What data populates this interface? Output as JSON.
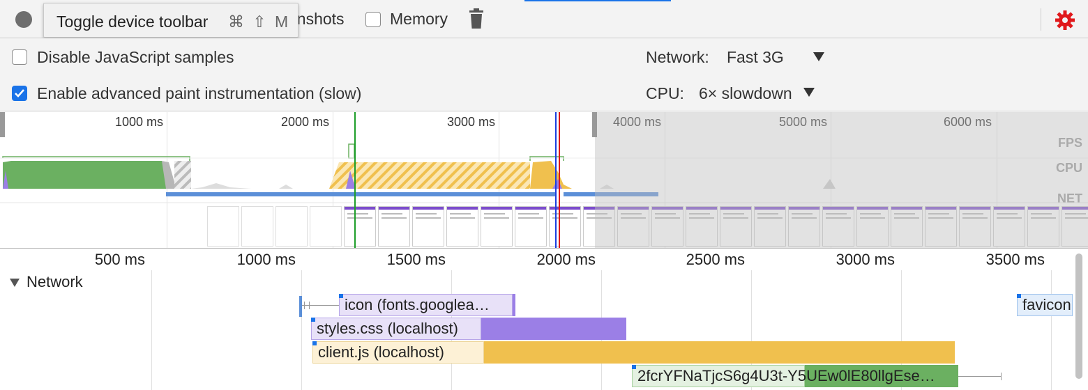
{
  "toolbar": {
    "tooltip_text": "Toggle device toolbar",
    "tooltip_shortcut": "⌘ ⇧ M",
    "screenshots_partial_label": "enshots",
    "memory_label": "Memory",
    "memory_checked": false
  },
  "settings": {
    "disable_js_samples_label": "Disable JavaScript samples",
    "disable_js_samples_checked": false,
    "advanced_paint_label": "Enable advanced paint instrumentation (slow)",
    "advanced_paint_checked": true,
    "network_label": "Network:",
    "network_value": "Fast 3G",
    "cpu_label": "CPU:",
    "cpu_value": "6× slowdown"
  },
  "overview": {
    "time_labels": [
      "1000 ms",
      "2000 ms",
      "3000 ms",
      "4000 ms",
      "5000 ms",
      "6000 ms"
    ],
    "tracks": [
      "FPS",
      "CPU",
      "NET"
    ]
  },
  "ruler": {
    "time_labels": [
      "500 ms",
      "1000 ms",
      "1500 ms",
      "2000 ms",
      "2500 ms",
      "3000 ms",
      "3500 ms"
    ]
  },
  "network": {
    "section_label": "Network",
    "requests": [
      {
        "label": "icon (fonts.googlea…",
        "color": "#9b7fe6"
      },
      {
        "label": "styles.css (localhost)",
        "color": "#9b7fe6"
      },
      {
        "label": "client.js (localhost)",
        "color": "#f0c04e"
      },
      {
        "label": "2fcrYFNaTjcS6g4U3t-Y5UEw0lE80llgEse…",
        "color": "#6bb061"
      },
      {
        "label": "favicon",
        "color": "#9fc3ec"
      }
    ]
  },
  "colors": {
    "accent": "#1a73e8",
    "settings_gear": "#e0181b",
    "scripting": "#f0c04e",
    "rendering": "#9b7fe6",
    "painting": "#6bb061",
    "network_bar": "#5b8fd8",
    "marker_green": "#1e9e2a",
    "marker_blue": "#1a3fe0",
    "marker_red": "#e01818"
  },
  "icons": [
    "record-icon",
    "trash-icon",
    "gear-icon",
    "checkbox-icon",
    "dropdown-caret-icon",
    "collapse-triangle-icon"
  ]
}
